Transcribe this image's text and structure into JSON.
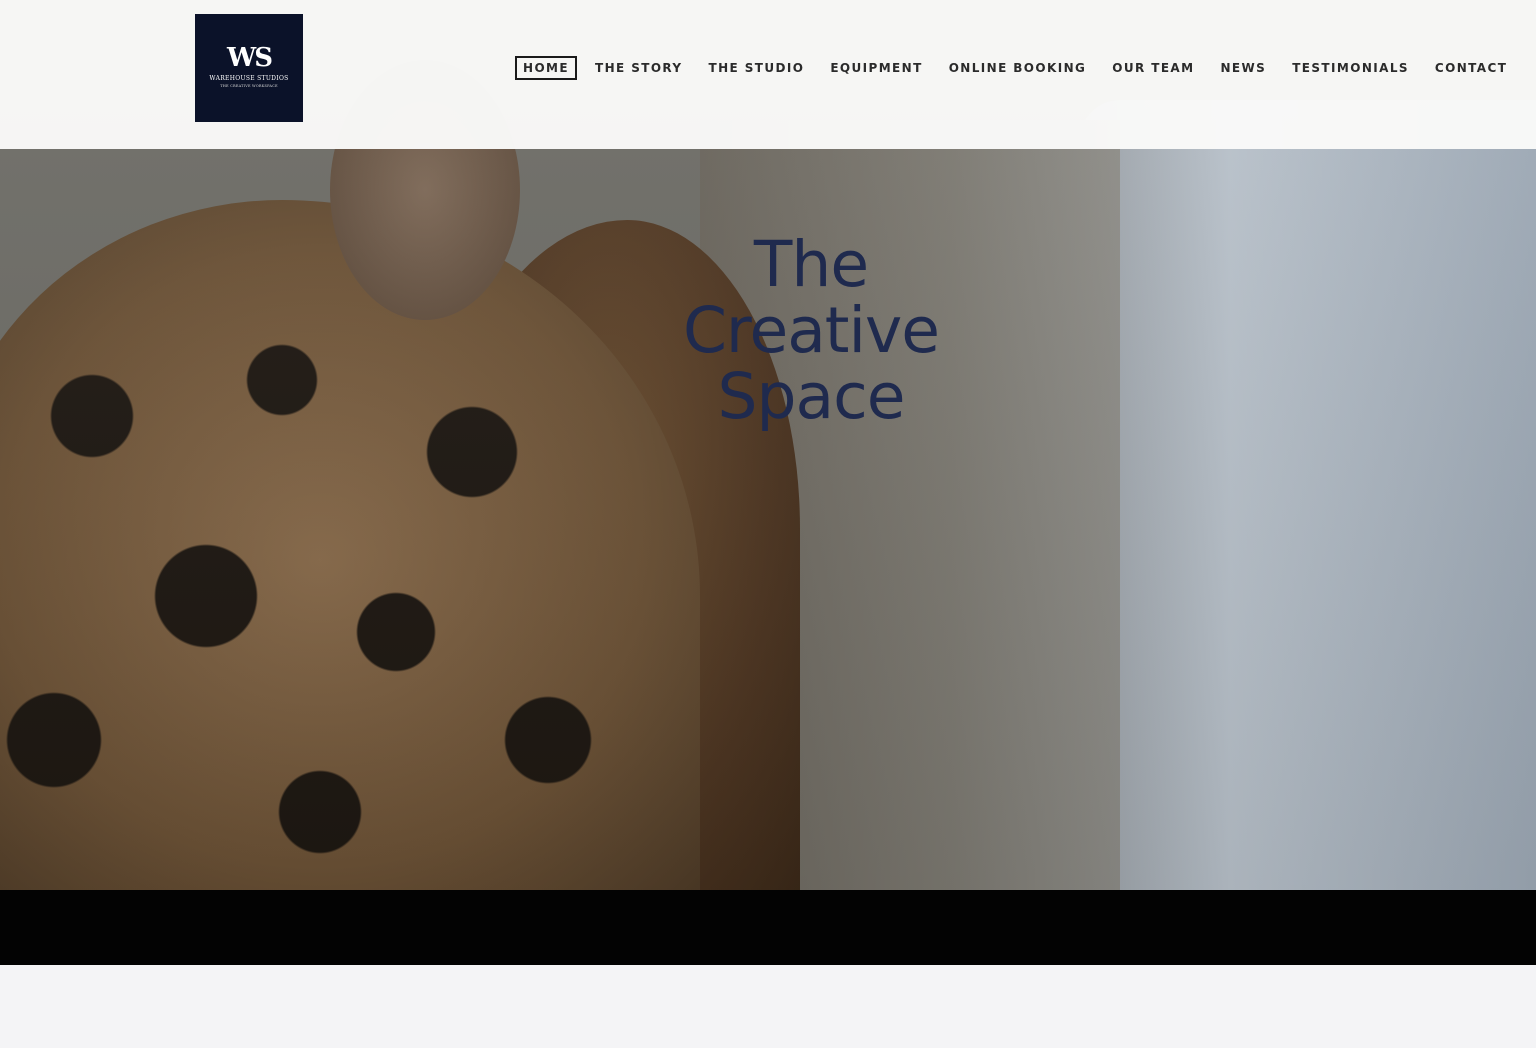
{
  "logo": {
    "mark": "WS",
    "name": "WAREHOUSE STUDIOS",
    "tagline": "THE CREATIVE WORKSPACE"
  },
  "nav": {
    "items": [
      {
        "label": "HOME",
        "active": true
      },
      {
        "label": "THE STORY"
      },
      {
        "label": "THE STUDIO"
      },
      {
        "label": "EQUIPMENT"
      },
      {
        "label": "ONLINE BOOKING"
      },
      {
        "label": "OUR TEAM"
      },
      {
        "label": "NEWS"
      },
      {
        "label": "TESTIMONIALS"
      },
      {
        "label": "CONTACT"
      }
    ]
  },
  "hero": {
    "title_lines": [
      "The",
      "Creative",
      "Space"
    ]
  },
  "colors": {
    "logo_bg": "#0b1229",
    "title": "#1f2a4e",
    "header_bg": "#fafaf9",
    "band": "#030303"
  }
}
